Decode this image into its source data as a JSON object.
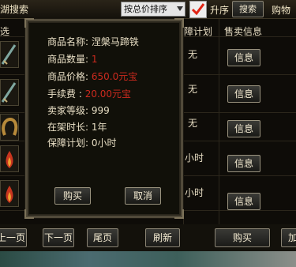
{
  "topbar": {
    "title": "湖搜索",
    "sort_select": "按总价排序",
    "ascending_label": "升序",
    "search_button": "搜索",
    "buy_tab": "购物"
  },
  "list": {
    "col_select": "选",
    "col_plan": "障计划",
    "col_info": "售卖信息",
    "rows": [
      {
        "plan": "无",
        "info_button": "信息"
      },
      {
        "plan": "无",
        "info_button": "信息"
      },
      {
        "plan": "无",
        "info_button": "信息"
      },
      {
        "plan": "小时",
        "info_button": "信息"
      },
      {
        "plan": "小时",
        "info_button": "信息"
      }
    ]
  },
  "dialog": {
    "fields": [
      {
        "label": "商品名称:",
        "value": "涅槃马蹄铁",
        "color": "#e6dcc2"
      },
      {
        "label": "商品数量:",
        "value": "1",
        "color": "#cc2a1e"
      },
      {
        "label": "商品价格:",
        "value": "650.0元宝",
        "color": "#cc2a1e"
      },
      {
        "label": "手续费 :",
        "value": "20.00元宝",
        "color": "#cc2a1e"
      },
      {
        "label": "卖家等级:",
        "value": "999",
        "color": "#e6dcc2"
      },
      {
        "label": "在架时长:",
        "value": "1年",
        "color": "#e6dcc2"
      },
      {
        "label": "保障计划:",
        "value": "0小时",
        "color": "#e6dcc2"
      }
    ],
    "buy_button": "购买",
    "cancel_button": "取消"
  },
  "bottombar": {
    "prev_page": "上一页",
    "next_page": "下一页",
    "last_page": "尾页",
    "refresh": "刷新",
    "buy": "购买",
    "add": "加"
  }
}
